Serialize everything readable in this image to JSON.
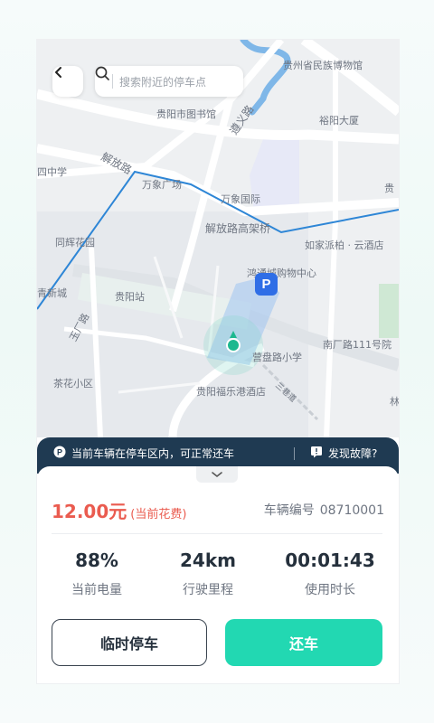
{
  "map": {
    "labels": {
      "top_partial": "",
      "museum": "贵州省民族博物馆",
      "east_edge": "",
      "library": "贵阳市图书馆",
      "zunyi_road": "遵义路",
      "yuyang": "裕阳大厦",
      "jiefang_road": "解放路",
      "wanxiang_square": "万象广场",
      "middle_school": "四中学",
      "wanxiang_intl": "万象国际",
      "guizhou_partial": "贵",
      "tonghui": "同辉花园",
      "jiefang_bridge": "解放路高架桥",
      "rujia": "如家派柏 · 云酒店",
      "mall": "鸿通城购物中心",
      "xinjie": "青新城",
      "guiyang_station": "贵阳站",
      "yuchang": "玉厂路",
      "nanchang_111": "南厂路111号院",
      "yingpan_school": "营盘路小学",
      "chahua": "茶花小区",
      "fule_hotel": "贵阳福乐港酒店",
      "sanmiao": "三巷道",
      "lin_partial": "林"
    },
    "icons": {
      "parking": "P"
    }
  },
  "search": {
    "placeholder": "搜索附近的停车点"
  },
  "notice": {
    "status_text": "当前车辆在停车区内，可正常还车",
    "report_text": "发现故障?"
  },
  "fee": {
    "amount": "12.00元",
    "note": "(当前花费)"
  },
  "vehicle": {
    "label": "车辆编号",
    "number": "08710001"
  },
  "stats": [
    {
      "value": "88%",
      "label": "当前电量"
    },
    {
      "value": "24km",
      "label": "行驶里程"
    },
    {
      "value": "00:01:43",
      "label": "使用时长"
    }
  ],
  "actions": {
    "temp_park": "临时停车",
    "return": "还车"
  },
  "colors": {
    "accent": "#22d8b2",
    "fee": "#ea5b4f",
    "notice_bg": "#1f3a52",
    "route": "#2e86d6"
  }
}
